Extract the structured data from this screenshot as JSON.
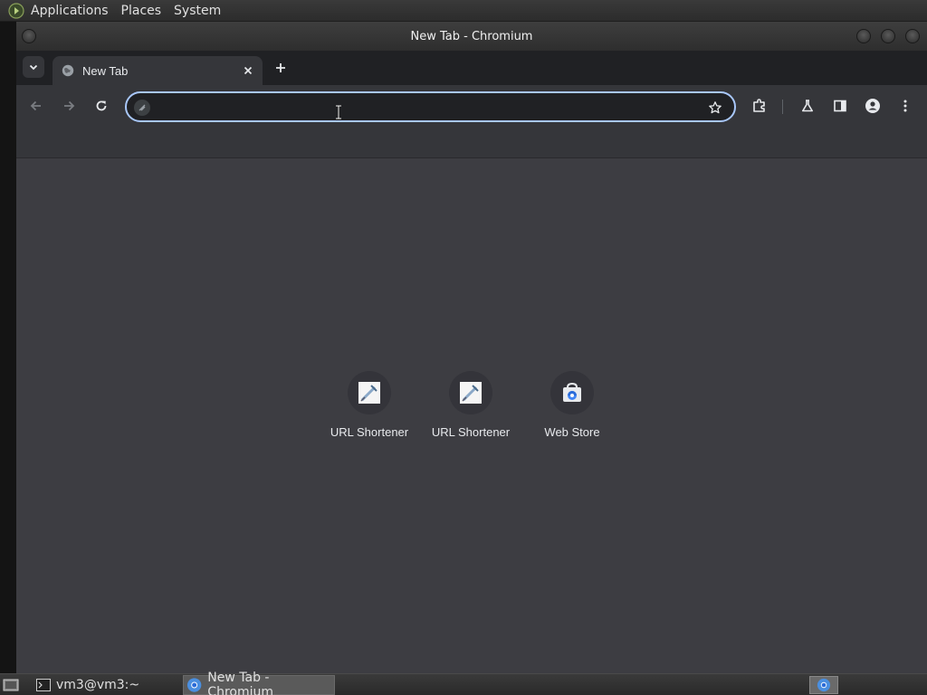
{
  "top_panel": {
    "menus": [
      "Applications",
      "Places",
      "System"
    ]
  },
  "window": {
    "title": "New Tab - Chromium"
  },
  "tabs": [
    {
      "title": "New Tab",
      "icon": "globe-icon"
    }
  ],
  "omnibox": {
    "value": "",
    "placeholder": ""
  },
  "shortcuts": [
    {
      "label": "URL Shortener",
      "icon": "url-shortener-favicon"
    },
    {
      "label": "URL Shortener",
      "icon": "url-shortener-favicon"
    },
    {
      "label": "Web Store",
      "icon": "web-store-icon"
    }
  ],
  "taskbar": {
    "terminal_label": "vm3@vm3:~",
    "browser_label": "New Tab - Chromium"
  },
  "colors": {
    "accent_focus": "#a8c7fa",
    "tab_strip": "#202124",
    "toolbar": "#35363a",
    "content_bg": "#3d3d42"
  }
}
